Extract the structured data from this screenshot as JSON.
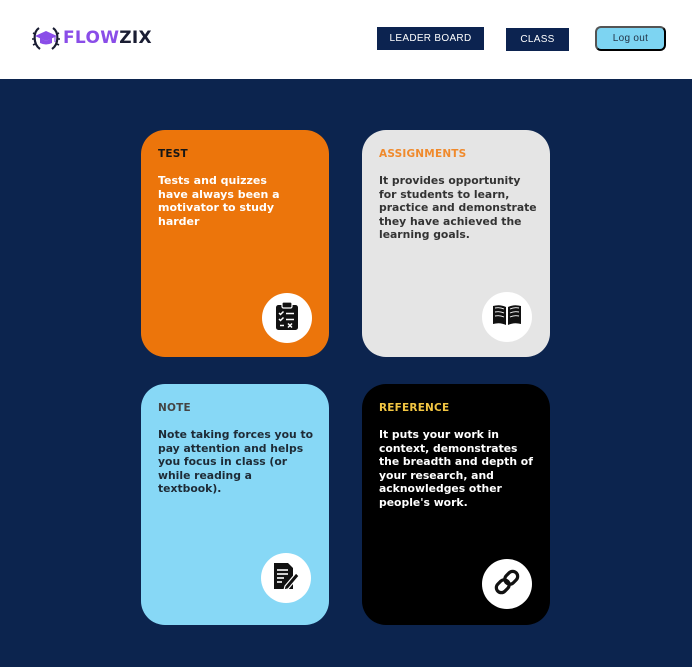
{
  "header": {
    "logo": {
      "part1": "FLOW",
      "part2": "ZIX",
      "icon": "graduation-cap-laurel-icon"
    },
    "nav": {
      "leader_board": "LEADER BOARD",
      "class": "CLASS"
    },
    "logout": "Log out"
  },
  "cards": [
    {
      "title": "TEST",
      "text": "Tests and quizzes have always been a motivator to study harder",
      "icon": "clipboard-checklist-icon"
    },
    {
      "title": "ASSIGNMENTS",
      "text": "It provides opportunity for students to learn, practice and demonstrate they have achieved the learning goals.",
      "icon": "open-book-icon"
    },
    {
      "title": "NOTE",
      "text": "Note taking forces you to pay attention and helps you focus in class (or while reading a textbook).",
      "icon": "document-edit-icon"
    },
    {
      "title": "REFERENCE",
      "text": "It puts your work in context, demonstrates the breadth and depth of your research, and acknowledges other people's work.",
      "icon": "link-icon"
    }
  ],
  "colors": {
    "navy": "#0c244e",
    "test": "#ec750b",
    "assignments": "#e5e5e5",
    "note": "#87d8f6",
    "reference": "#000000",
    "accent_orange": "#f08a2c",
    "accent_yellow": "#f1c542",
    "logout": "#7dd4f2",
    "brand_purple": "#8a4de8"
  }
}
